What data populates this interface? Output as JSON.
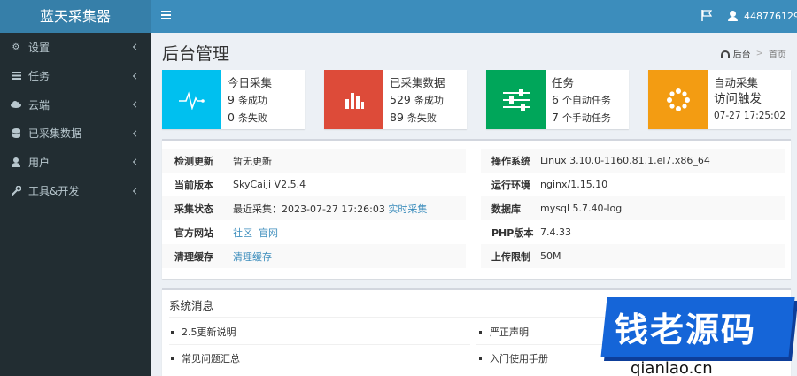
{
  "app": {
    "title": "蓝天采集器"
  },
  "header": {
    "username": "448776129"
  },
  "sidebar": {
    "items": [
      {
        "label": "设置",
        "icon": "gear-icon"
      },
      {
        "label": "任务",
        "icon": "tasks-icon"
      },
      {
        "label": "云端",
        "icon": "cloud-icon"
      },
      {
        "label": "已采集数据",
        "icon": "database-icon"
      },
      {
        "label": "用户",
        "icon": "user-icon"
      },
      {
        "label": "工具&开发",
        "icon": "wrench-icon"
      }
    ]
  },
  "page": {
    "title": "后台管理"
  },
  "breadcrumb": {
    "home": "后台",
    "sep": ">",
    "current": "首页"
  },
  "infoboxes": [
    {
      "title": "今日采集",
      "line1_num": "9",
      "line1_unit": "条成功",
      "line2_num": "0",
      "line2_unit": "条失败",
      "color": "#00c0ef",
      "icon": "pulse-icon"
    },
    {
      "title": "已采集数据",
      "line1_num": "529",
      "line1_unit": "条成功",
      "line2_num": "89",
      "line2_unit": "条失败",
      "color": "#dd4b39",
      "icon": "bar-chart-icon"
    },
    {
      "title": "任务",
      "line1_num": "6",
      "line1_unit": "个自动任务",
      "line2_num": "7",
      "line2_unit": "个手动任务",
      "color": "#00a65a",
      "icon": "sliders-icon"
    },
    {
      "title": "自动采集",
      "line1": "访问触发",
      "time": "07-27 17:25:02",
      "color": "#f39c12",
      "icon": "spinner-icon"
    }
  ],
  "info": {
    "left": [
      {
        "label": "检测更新",
        "value": "暂无更新"
      },
      {
        "label": "当前版本",
        "value": "SkyCaiji V2.5.4"
      },
      {
        "label": "采集状态",
        "value": "最近采集：2023-07-27 17:26:03",
        "link": "实时采集"
      },
      {
        "label": "官方网站",
        "link1": "社区",
        "link2": "官网"
      },
      {
        "label": "清理缓存",
        "link": "清理缓存"
      }
    ],
    "right": [
      {
        "label": "操作系统",
        "value": "Linux 3.10.0-1160.81.1.el7.x86_64"
      },
      {
        "label": "运行环境",
        "value": "nginx/1.15.10"
      },
      {
        "label": "数据库",
        "value": "mysql 5.7.40-log"
      },
      {
        "label": "PHP版本",
        "value": "7.4.33"
      },
      {
        "label": "上传限制",
        "value": "50M"
      }
    ]
  },
  "messages": {
    "title": "系统消息",
    "items": [
      "2.5更新说明",
      "严正声明",
      "常见问题汇总",
      "入门使用手册"
    ]
  },
  "watermark": {
    "text": "钱老源码",
    "url": "qianlao.cn"
  }
}
